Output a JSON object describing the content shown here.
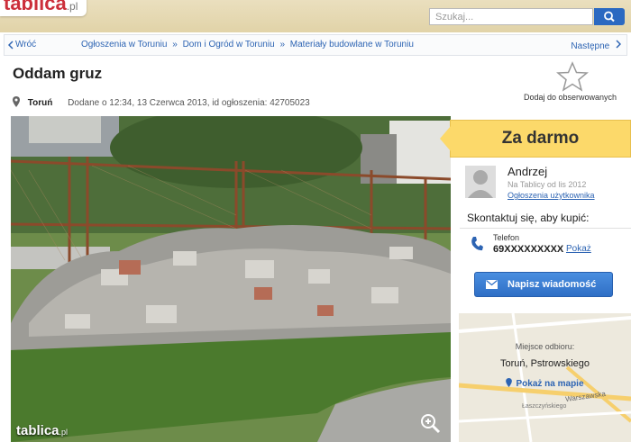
{
  "header": {
    "logo": "tablica",
    "logo_suffix": ".pl",
    "search_placeholder": "Szukaj..."
  },
  "breadcrumb": {
    "back_label": "Wróć",
    "items": [
      "Ogłoszenia w Toruniu",
      "»",
      "Dom i Ogród w Toruniu",
      "»",
      "Materiały budowlane w Toruniu"
    ],
    "next_label": "Następne"
  },
  "ad": {
    "title": "Oddam gruz",
    "city": "Toruń",
    "meta": "Dodane o 12:34, 13 Czerwca 2013, id ogłoszenia: 42705023",
    "observe_label": "Dodaj do obserwowanych"
  },
  "photo": {
    "watermark": "tablica",
    "watermark_suffix": ".pl"
  },
  "sidebar": {
    "price": "Za darmo",
    "user_name": "Andrzej",
    "since": "Na Tablicy od lis 2012",
    "user_ads_link": "Ogłoszenia użytkownika",
    "contact_heading": "Skontaktuj się, aby kupić:",
    "phone_label": "Telefon",
    "phone_number": "69XXXXXXXXX",
    "phone_show": "Pokaż",
    "message_button": "Napisz wiadomość",
    "pickup_label": "Miejsce odbioru:",
    "pickup_place": "Toruń, Pstrowskiego",
    "map_link": "Pokaż na mapie",
    "map_street_1": "Warszawska",
    "map_street_2": "Łaszczyńskiego"
  },
  "colors": {
    "brand": "#cc2f3b",
    "link": "#2d64b3",
    "price_bg": "#fcd96a",
    "button": "#2f6fc6"
  },
  "icons": [
    "search-icon",
    "back-chevron-icon",
    "next-chevron-icon",
    "location-pin-icon",
    "star-icon",
    "zoom-icon",
    "phone-icon",
    "envelope-icon",
    "avatar-icon",
    "map-pin-icon"
  ]
}
